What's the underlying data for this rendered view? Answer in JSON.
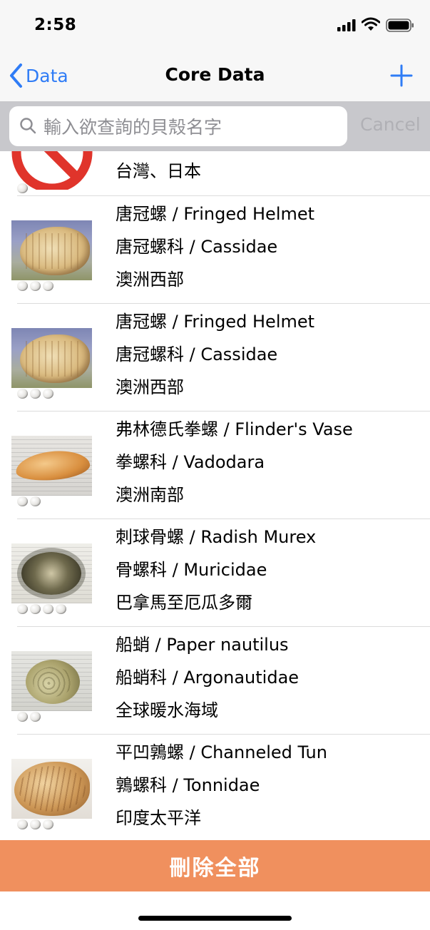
{
  "status_bar": {
    "time": "2:58"
  },
  "nav": {
    "back_label": "Data",
    "title": "Core Data"
  },
  "search": {
    "placeholder": "輸入欲查詢的貝殼名字",
    "cancel_label": "Cancel"
  },
  "rows": [
    {
      "partial": true,
      "line3": "台灣、日本"
    },
    {
      "line1": "唐冠螺 / Fringed Helmet",
      "line2": "唐冠螺科 / Cassidae",
      "line3": "澳洲西部",
      "rating": 3
    },
    {
      "line1": "唐冠螺 / Fringed Helmet",
      "line2": "唐冠螺科 / Cassidae",
      "line3": "澳洲西部",
      "rating": 3
    },
    {
      "line1": "弗林德氏拳螺 / Flinder's Vase",
      "line2": "拳螺科 / Vadodara",
      "line3": "澳洲南部",
      "rating": 2
    },
    {
      "line1": "刺球骨螺 / Radish Murex",
      "line2": "骨螺科 / Muricidae",
      "line3": "巴拿馬至厄瓜多爾",
      "rating": 4
    },
    {
      "line1": "船蛸 / Paper nautilus",
      "line2": "船蛸科 / Argonautidae",
      "line3": "全球暖水海域",
      "rating": 2
    },
    {
      "line1": "平凹鶉螺 / Channeled Tun",
      "line2": "鶉螺科 / Tonnidae",
      "line3": "印度太平洋",
      "rating": 3
    }
  ],
  "footer": {
    "delete_all_label": "刪除全部"
  },
  "colors": {
    "accent": "#2f7cf6",
    "delete_bg": "#f0905e",
    "search_bar_bg": "#c8c8cc"
  },
  "icons": [
    "signal-icon",
    "wifi-icon",
    "battery-icon",
    "back-chevron-icon",
    "plus-icon",
    "search-icon",
    "no-image-icon"
  ]
}
